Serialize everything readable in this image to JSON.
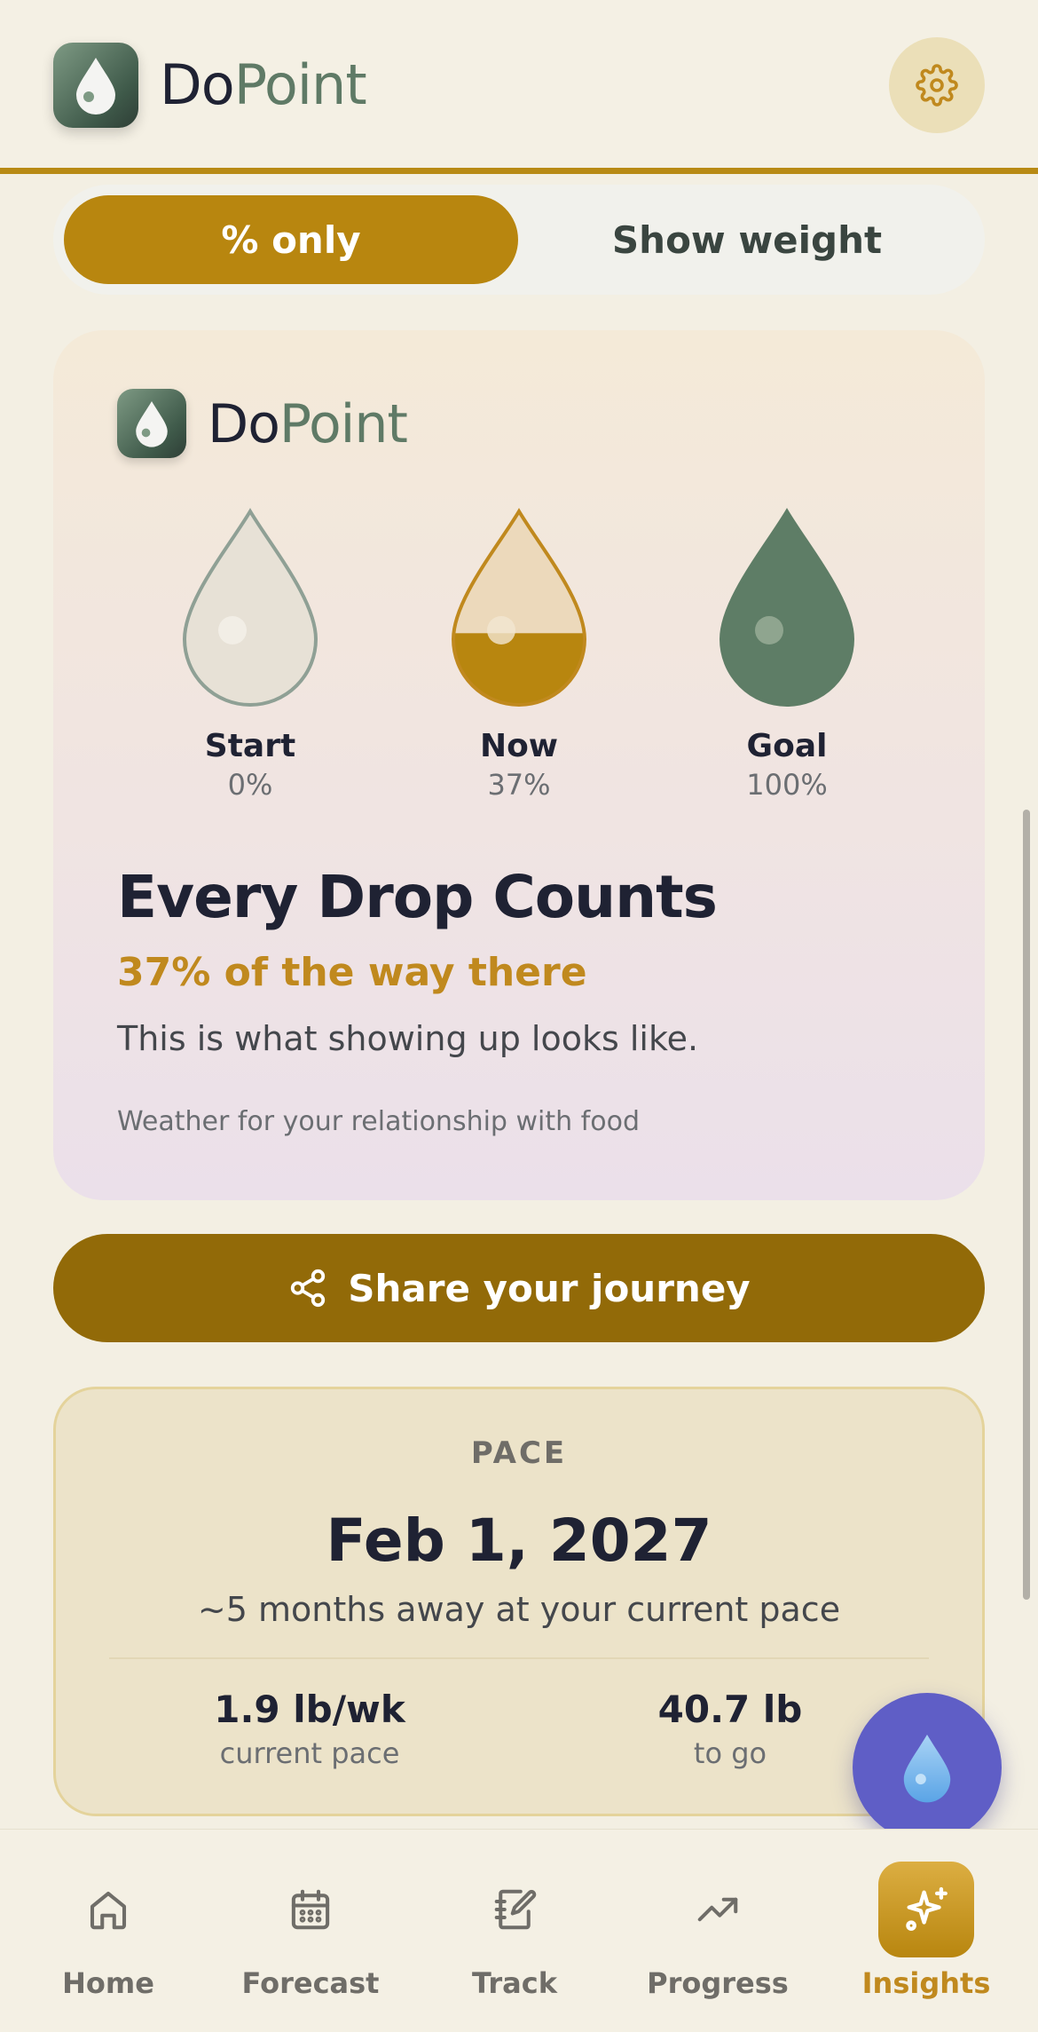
{
  "header": {
    "brand_do": "Do",
    "brand_point": "Point",
    "settings_icon": "gear-icon"
  },
  "toggle": {
    "percent_label": "% only",
    "weight_label": "Show weight",
    "selected": "percent"
  },
  "share_card": {
    "brand_do": "Do",
    "brand_point": "Point",
    "drops": [
      {
        "label": "Start",
        "value": "0%",
        "fill": 0
      },
      {
        "label": "Now",
        "value": "37%",
        "fill": 0.37
      },
      {
        "label": "Goal",
        "value": "100%",
        "fill": 1
      }
    ],
    "title": "Every Drop Counts",
    "subtitle": "37% of the way there",
    "line": "This is what showing up looks like.",
    "tagline": "Weather for your relationship with food"
  },
  "share_button": {
    "label": "Share your journey",
    "icon": "share-icon"
  },
  "pace": {
    "label": "PACE",
    "date": "Feb 1, 2027",
    "description": "~5 months away at your current pace",
    "stats": [
      {
        "value": "1.9 lb/wk",
        "label": "current pace"
      },
      {
        "value": "40.7 lb",
        "label": "to go"
      }
    ]
  },
  "fab": {
    "icon": "water-drop-icon"
  },
  "nav": {
    "items": [
      {
        "label": "Home",
        "icon": "home-icon"
      },
      {
        "label": "Forecast",
        "icon": "calendar-icon"
      },
      {
        "label": "Track",
        "icon": "notebook-icon"
      },
      {
        "label": "Progress",
        "icon": "trend-up-icon"
      },
      {
        "label": "Insights",
        "icon": "sparkle-icon"
      }
    ],
    "active": "Insights"
  },
  "colors": {
    "accent": "#b8860f",
    "share_button": "#926a08",
    "brand_green": "#5f7a66",
    "fab": "#5f5ec6"
  }
}
